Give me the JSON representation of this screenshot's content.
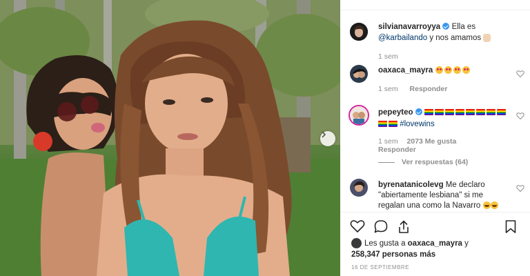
{
  "post": {
    "author": "silvianavarroyya",
    "caption_prefix": "Ella es ",
    "caption_mention": "@karbailando",
    "caption_suffix": " y nos amamos",
    "time": "1 sem"
  },
  "comments": [
    {
      "user": "oaxaca_mayra",
      "emoji_icons": [
        "heart-eyes-emoji",
        "heart-eyes-emoji",
        "heart-eyes-emoji",
        "heart-eyes-emoji"
      ],
      "time": "1 sem",
      "reply_label": "Responder"
    },
    {
      "user": "pepeyteo",
      "line2_text": "#lovewins",
      "time": "1 sem",
      "likes": "2073 Me gusta",
      "reply_label": "Responder",
      "view_replies": "Ver respuestas (64)"
    },
    {
      "user": "byrenatanicolevg",
      "text_line1": "Me declaro",
      "text_line2": "\"abiertamente lesbiana\" si me",
      "text_line3_prefix": "regalan una como la Navarro"
    }
  ],
  "likes": {
    "prefix": "Les gusta a ",
    "user": "oaxaca_mayra",
    "conj": " y",
    "count": "258,347 personas más"
  },
  "date": "16 DE SEPTIEMBRE",
  "icons": {
    "like": "heart-outline-icon",
    "comment": "comment-bubble-icon",
    "share": "share-icon",
    "save": "bookmark-icon",
    "next": "chevron-right-icon"
  },
  "colors": {
    "link": "#00376b",
    "meta": "#8e8e8e",
    "verified": "#3897f0",
    "text": "#262626"
  }
}
